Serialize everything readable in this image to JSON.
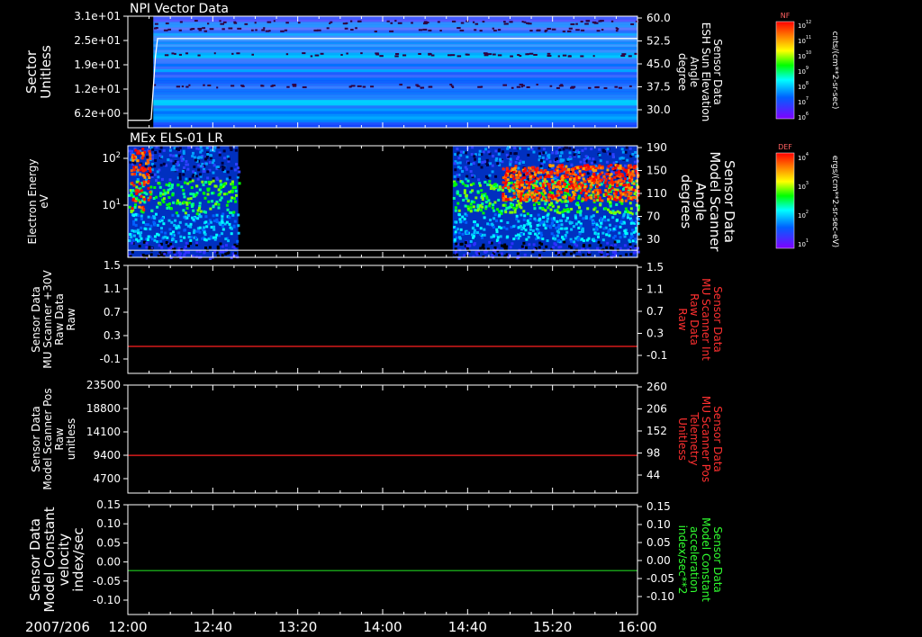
{
  "date_label": "2007/206",
  "time_ticks": [
    "12:00",
    "12:40",
    "13:20",
    "14:00",
    "14:40",
    "15:20",
    "16:00"
  ],
  "chart_data": [
    {
      "id": "npi",
      "type": "heatmap",
      "title": "NPI Vector Data",
      "ylabel": [
        "Sector",
        "Unitless"
      ],
      "yticks": [
        "3.1e+01",
        "2.5e+01",
        "1.9e+01",
        "1.2e+01",
        "6.2e+00"
      ],
      "ylim": [
        0,
        31
      ],
      "right_label": [
        "Sensor Data",
        "ESH Sun Elevation",
        "Angle",
        "degree"
      ],
      "right_ticks": [
        "60.0",
        "52.5",
        "45.0",
        "37.5",
        "30.0"
      ],
      "right_ylim": [
        22.5,
        60
      ],
      "overlay_series": {
        "name": "",
        "x": [
          "12:00",
          "12:10",
          "12:11",
          "12:13",
          "12:14",
          "16:00"
        ],
        "y": [
          25.0,
          25.0,
          25.5,
          46.5,
          52.5,
          52.5
        ]
      },
      "colorbar": {
        "label": "NF",
        "unit": "cnts/(cm**2-sr-sec)",
        "ticks": [
          "10^12",
          "10^11",
          "10^10",
          "10^9",
          "10^8",
          "10^7",
          "10^6"
        ]
      }
    },
    {
      "id": "els",
      "type": "heatmap",
      "title": "MEx ELS-01 LR",
      "ylabel": [
        "Electron Energy",
        "eV"
      ],
      "yticks": [
        "10^2",
        "10^1"
      ],
      "right_label": [
        "Sensor Data",
        "Model Scanner",
        "Angle",
        "degrees"
      ],
      "right_ticks": [
        "190",
        "150",
        "110",
        "70",
        "30"
      ],
      "right_ylim": [
        0,
        190
      ],
      "overlay_series": {
        "name": "",
        "x": [
          "12:00",
          "16:00"
        ],
        "y": [
          12,
          12
        ]
      },
      "colorbar": {
        "label": "DEF",
        "unit": "ergs/(cm**2-sr-sec-eV)",
        "ticks": [
          "10^4",
          "10^3",
          "10^2",
          "10^1"
        ]
      }
    },
    {
      "id": "raw30",
      "type": "line",
      "ylabel": [
        "Sensor Data",
        "MU Scanner +30V",
        "Raw Data",
        "Raw"
      ],
      "yticks": [
        "1.5",
        "1.1",
        "0.7",
        "0.3",
        "-0.1"
      ],
      "ylim": [
        -0.5,
        1.5
      ],
      "right_label": [
        "Sensor Data",
        "MU Scanner Int",
        "Raw Data",
        "Raw"
      ],
      "right_ticks": [
        "1.5",
        "1.1",
        "0.7",
        "0.3",
        "-0.1"
      ],
      "right_color": "#ff3030",
      "series": [
        {
          "name": "",
          "color": "#ff2020",
          "x": [
            "12:00",
            "16:00"
          ],
          "y": [
            0.0,
            0.0
          ]
        }
      ]
    },
    {
      "id": "pos",
      "type": "line",
      "ylabel": [
        "Sensor Data",
        "Model Scanner Pos",
        "Raw",
        "unitless"
      ],
      "yticks": [
        "23500",
        "18800",
        "14100",
        "9400",
        "4700"
      ],
      "ylim": [
        0,
        23500
      ],
      "right_label": [
        "Sensor Data",
        "MU Scanner Pos",
        "Telemetry",
        "Unitless"
      ],
      "right_ticks": [
        "260",
        "206",
        "152",
        "98",
        "44"
      ],
      "right_color": "#ff3030",
      "series": [
        {
          "name": "",
          "color": "#ff2020",
          "x": [
            "12:00",
            "16:00"
          ],
          "y": [
            8200,
            8200
          ]
        }
      ]
    },
    {
      "id": "vel",
      "type": "line",
      "ylabel": [
        "Sensor Data",
        "Model Constant",
        "velocity",
        "index/sec"
      ],
      "yticks": [
        "0.15",
        "0.10",
        "0.05",
        "0.00",
        "-0.05",
        "-0.10"
      ],
      "ylim": [
        -0.1,
        0.15
      ],
      "right_label": [
        "Sensor Data",
        "Model Constant",
        "acceleration",
        "index/sec**2"
      ],
      "right_ticks": [
        "0.15",
        "0.10",
        "0.05",
        "0.00",
        "-0.05",
        "-0.10"
      ],
      "right_color": "#30ff30",
      "series": [
        {
          "name": "",
          "color": "#20d020",
          "x": [
            "12:00",
            "16:00"
          ],
          "y": [
            0.0,
            0.0
          ]
        }
      ]
    }
  ]
}
